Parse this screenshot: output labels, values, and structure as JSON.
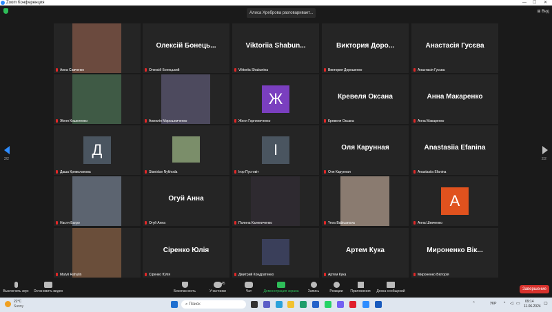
{
  "window": {
    "title": "Zoom Конференция"
  },
  "topbar": {
    "speaking": "Алиса Хреброва разговаривает...",
    "view_label": "Вид"
  },
  "nav": {
    "page_left": "2/2",
    "page_right": "2/2"
  },
  "tiles": [
    {
      "name": "Анна Савченко",
      "kind": "photo",
      "photo_color": "#6b4a3e"
    },
    {
      "name": "Олексій Бонецький",
      "kind": "text",
      "big": "Олексій Бонець..."
    },
    {
      "name": "Viktoriia Shabunina",
      "kind": "text",
      "big": "Viktoriia Shabun..."
    },
    {
      "name": "Виктория Дорошенко",
      "kind": "text",
      "big": "Виктория Доро..."
    },
    {
      "name": "Анастасія Гусєва",
      "kind": "text",
      "big": "Анастасія Гусєва"
    },
    {
      "name": "Женя Кошеленко",
      "kind": "photo",
      "photo_color": "#3f5a45"
    },
    {
      "name": "Анжелiя Мирошниченко",
      "kind": "photo",
      "photo_color": "#4d4a5e"
    },
    {
      "name": "Женя Горпиниченко",
      "kind": "avatar",
      "letter": "Ж",
      "color": "#7a3fbf"
    },
    {
      "name": "Кревеля Оксана",
      "kind": "text",
      "big": "Кревеля Оксана"
    },
    {
      "name": "Анна Макаренко",
      "kind": "text",
      "big": "Анна Макаренко"
    },
    {
      "name": "Даша Криволапова",
      "kind": "avatar",
      "letter": "Д",
      "color": "#4a5560"
    },
    {
      "name": "Stanislav Nykhoda",
      "kind": "photo-small",
      "photo_color": "#7b8e6a"
    },
    {
      "name": "Ігор Пустовіт",
      "kind": "avatar",
      "letter": "І",
      "color": "#4a5560"
    },
    {
      "name": "Оля Карунная",
      "kind": "text",
      "big": "Оля Карунная"
    },
    {
      "name": "Anastasiia Efanina",
      "kind": "text",
      "big": "Anastasiia Efanina"
    },
    {
      "name": "Настя Багро",
      "kind": "photo",
      "photo_color": "#5c6470"
    },
    {
      "name": "Огуй Анна",
      "kind": "text",
      "big": "Огуй Анна"
    },
    {
      "name": "Полина Калениченко",
      "kind": "photo",
      "photo_color": "#2e2a30"
    },
    {
      "name": "Yeva Babiuanova",
      "kind": "photo",
      "photo_color": "#8a7b70"
    },
    {
      "name": "Анна Шевченко",
      "kind": "avatar",
      "letter": "А",
      "color": "#e0521e"
    },
    {
      "name": "Matvii Rahulin",
      "kind": "photo",
      "photo_color": "#6a4e3a"
    },
    {
      "name": "Сіренко Юлія",
      "kind": "text",
      "big": "Сіренко Юлія"
    },
    {
      "name": "Дмитрий Кондратенко",
      "kind": "photo-small",
      "photo_color": "#3a3f5a"
    },
    {
      "name": "Артем Кука",
      "kind": "text",
      "big": "Артем Кука"
    },
    {
      "name": "Мироненко Вікторія",
      "kind": "text",
      "big": "Мироненко Вік..."
    }
  ],
  "toolbar": {
    "mute": "Выключить звук",
    "video": "Остановить видео",
    "security": "Безопасность",
    "participants": "Участники",
    "participants_count": "45",
    "chat": "Чат",
    "share": "Демонстрация экрана",
    "record": "Запись",
    "reactions": "Реакции",
    "apps": "Приложения",
    "whiteboard": "Доска сообщений",
    "end": "Завершение"
  },
  "taskbar": {
    "temp": "22°C",
    "weather": "Sunny",
    "search_placeholder": "Поиск",
    "lang": "УКР",
    "time": "09:14",
    "date": "11.06.2024"
  },
  "colors": {
    "share_green": "#2ebd59",
    "end_red": "#d8322d",
    "accent_blue": "#2d8cff"
  }
}
